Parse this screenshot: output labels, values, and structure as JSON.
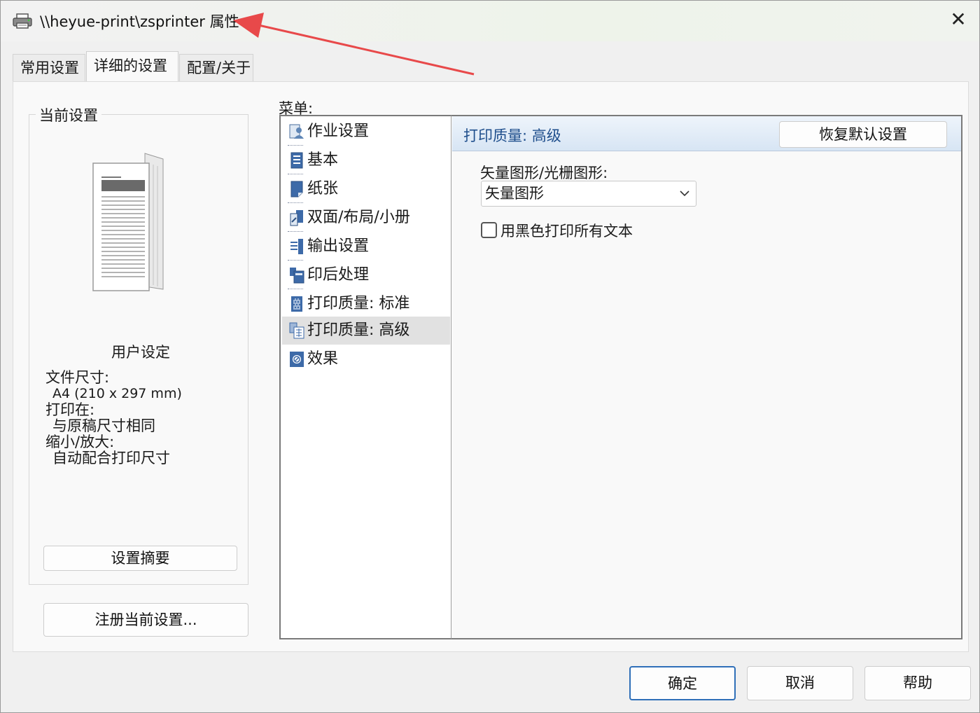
{
  "window": {
    "title": "\\\\heyue-print\\zsprinter 属性",
    "close": "✕"
  },
  "tabs": [
    {
      "label": "常用设置"
    },
    {
      "label": "详细的设置"
    },
    {
      "label": "配置/关于"
    }
  ],
  "current_settings": {
    "legend": "当前设置",
    "user_setting": "用户设定",
    "doc_size_label": "文件尺寸:",
    "doc_size_value": "A4 (210 x 297 mm)",
    "print_on_label": "打印在:",
    "print_on_value": "与原稿尺寸相同",
    "scale_label": "缩小/放大:",
    "scale_value": "自动配合打印尺寸",
    "summary_button": "设置摘要"
  },
  "register_button": "注册当前设置...",
  "menu": {
    "label": "菜单:",
    "items": [
      {
        "label": "作业设置",
        "icon": "job-settings-icon"
      },
      {
        "label": "基本",
        "icon": "basic-icon"
      },
      {
        "label": "纸张",
        "icon": "paper-icon"
      },
      {
        "label": "双面/布局/小册",
        "icon": "duplex-layout-icon"
      },
      {
        "label": "输出设置",
        "icon": "output-icon"
      },
      {
        "label": "印后处理",
        "icon": "finishing-icon"
      },
      {
        "label": "打印质量: 标准",
        "icon": "quality-standard-icon"
      },
      {
        "label": "打印质量: 高级",
        "icon": "quality-advanced-icon"
      },
      {
        "label": "效果",
        "icon": "effects-icon"
      }
    ],
    "selected": "打印质量: 高级"
  },
  "detail": {
    "title": "打印质量: 高级",
    "restore_button": "恢复默认设置",
    "graphics_label": "矢量图形/光栅图形:",
    "graphics_value": "矢量图形",
    "black_text_label": "用黑色打印所有文本",
    "black_text_checked": false
  },
  "footer": {
    "ok": "确定",
    "cancel": "取消",
    "help": "帮助"
  },
  "colors": {
    "accent": "#2f6fb8",
    "header_title": "#1e4e8c",
    "annotation_arrow": "#e8494a"
  }
}
